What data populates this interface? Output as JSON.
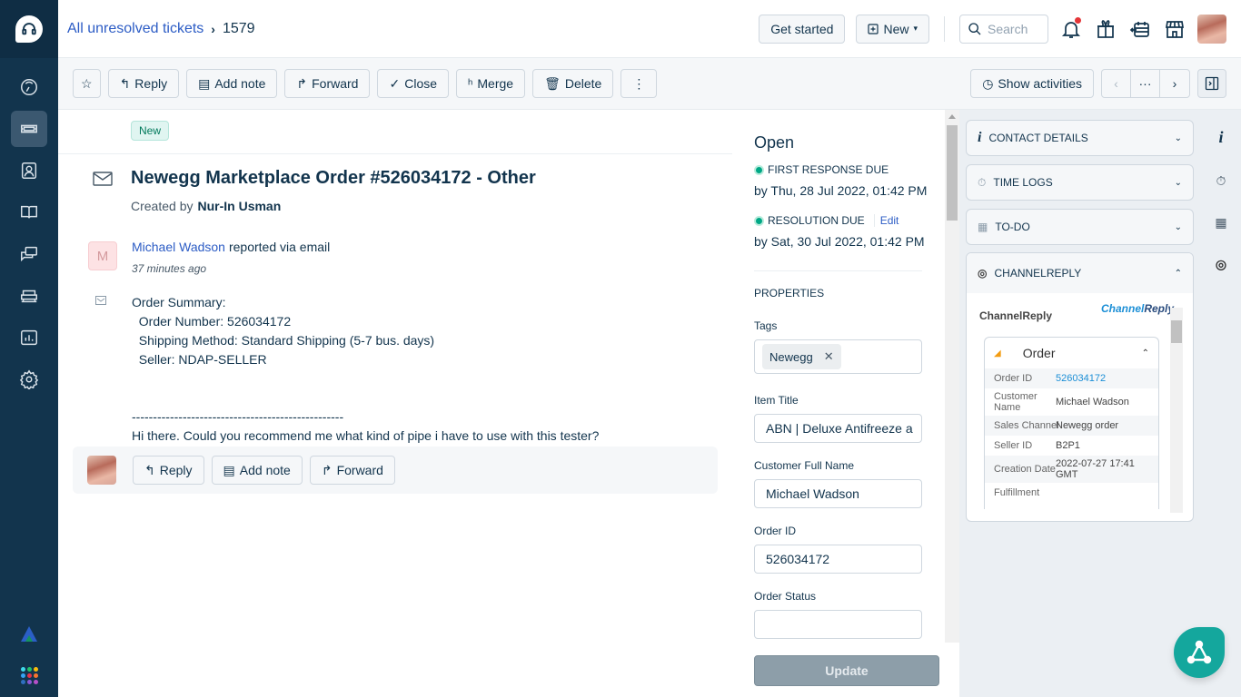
{
  "breadcrumb": {
    "parent": "All unresolved tickets",
    "current": "1579"
  },
  "topbar": {
    "get_started": "Get started",
    "new_label": "New",
    "search_placeholder": "Search"
  },
  "toolbar": {
    "reply": "Reply",
    "add_note": "Add note",
    "forward": "Forward",
    "close": "Close",
    "merge": "Merge",
    "delete": "Delete",
    "more": "⋮",
    "show_activities": "Show activities",
    "pager_prev": "‹",
    "pager_more": "···",
    "pager_next": "›"
  },
  "ticket": {
    "status_badge": "New",
    "subject": "Newegg Marketplace Order #526034172 - Other",
    "created_by_label": "Created by",
    "created_by": "Nur-In Usman",
    "message": {
      "avatar_initial": "M",
      "sender": "Michael Wadson",
      "via": "reported via email",
      "time": "37 minutes ago",
      "body": "Order Summary:\n  Order Number: 526034172\n  Shipping Method: Standard Shipping (5-7 bus. days)\n  Seller: NDAP-SELLER\n\n\n--------------------------------------------------\nHi there. Could you recommend me what kind of pipe i have to use with this tester?"
    },
    "reply_bar": {
      "reply": "Reply",
      "add_note": "Add note",
      "forward": "Forward"
    }
  },
  "properties": {
    "status": "Open",
    "first_response_label": "FIRST RESPONSE DUE",
    "first_response_date": "by Thu, 28 Jul 2022, 01:42 PM",
    "resolution_label": "RESOLUTION DUE",
    "resolution_edit": "Edit",
    "resolution_date": "by Sat, 30 Jul 2022, 01:42 PM",
    "heading": "PROPERTIES",
    "tags_label": "Tags",
    "tags": [
      "Newegg"
    ],
    "item_title_label": "Item Title",
    "item_title_value": "ABN | Deluxe Antifreeze a",
    "customer_name_label": "Customer Full Name",
    "customer_name_value": "Michael Wadson",
    "order_id_label": "Order ID",
    "order_id_value": "526034172",
    "order_status_label": "Order Status",
    "order_status_value": "",
    "update_button": "Update"
  },
  "right_panel": {
    "contact_details": "CONTACT DETAILS",
    "time_logs": "TIME LOGS",
    "todo": "TO-DO",
    "channelreply": "CHANNELREPLY",
    "channelreply_title": "ChannelReply",
    "channelreply_logo_a": "Channel",
    "channelreply_logo_b": "Reply",
    "order": {
      "title": "Order",
      "rows": [
        {
          "key": "Order ID",
          "value": "526034172"
        },
        {
          "key": "Customer Name",
          "value": "Michael Wadson"
        },
        {
          "key": "Sales Channel",
          "value": "Newegg order"
        },
        {
          "key": "Seller ID",
          "value": "B2P1"
        },
        {
          "key": "Creation Date",
          "value": "2022-07-27 17:41 GMT"
        },
        {
          "key": "Fulfillment",
          "value": ""
        }
      ]
    }
  },
  "colors": {
    "sidebar": "#12344d",
    "link": "#2c5cc5",
    "accent_green": "#00a886",
    "fab": "#14a79d",
    "update_disabled": "#8d9ea9"
  }
}
